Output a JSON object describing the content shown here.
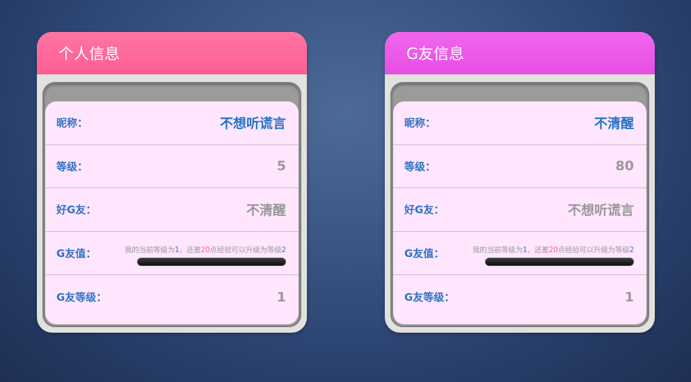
{
  "left_card": {
    "title": "个人信息",
    "rows": {
      "nickname_label": "昵称：",
      "nickname_value": "不想听谎言",
      "level_label": "等级：",
      "level_value": "5",
      "friend_label": "好G友：",
      "friend_value": "不清醒",
      "gvalue_label": "G友值：",
      "exp_prefix": "我的当前等级为",
      "exp_current_level": "1",
      "exp_mid": "，还差",
      "exp_points": "20",
      "exp_suffix": "点经验可以升级为等级",
      "exp_next_level": "2",
      "exp_progress": 0,
      "glevel_label": "G友等级：",
      "glevel_value": "1"
    }
  },
  "right_card": {
    "title": "G友信息",
    "rows": {
      "nickname_label": "昵称：",
      "nickname_value": "不清醒",
      "level_label": "等级：",
      "level_value": "80",
      "friend_label": "好G友：",
      "friend_value": "不想听谎言",
      "gvalue_label": "G友值：",
      "exp_prefix": "我的当前等级为",
      "exp_current_level": "1",
      "exp_mid": "，还差",
      "exp_points": "20",
      "exp_suffix": "点经验可以升级为等级",
      "exp_next_level": "2",
      "exp_progress": 0,
      "glevel_label": "G友等级：",
      "glevel_value": "1"
    }
  },
  "colors": {
    "left_header": "#ff5f95",
    "right_header": "#e84fe4",
    "label_blue": "#2f73c2",
    "highlight_pink": "#ff5b99",
    "panel_bg": "#ffe6fe"
  }
}
